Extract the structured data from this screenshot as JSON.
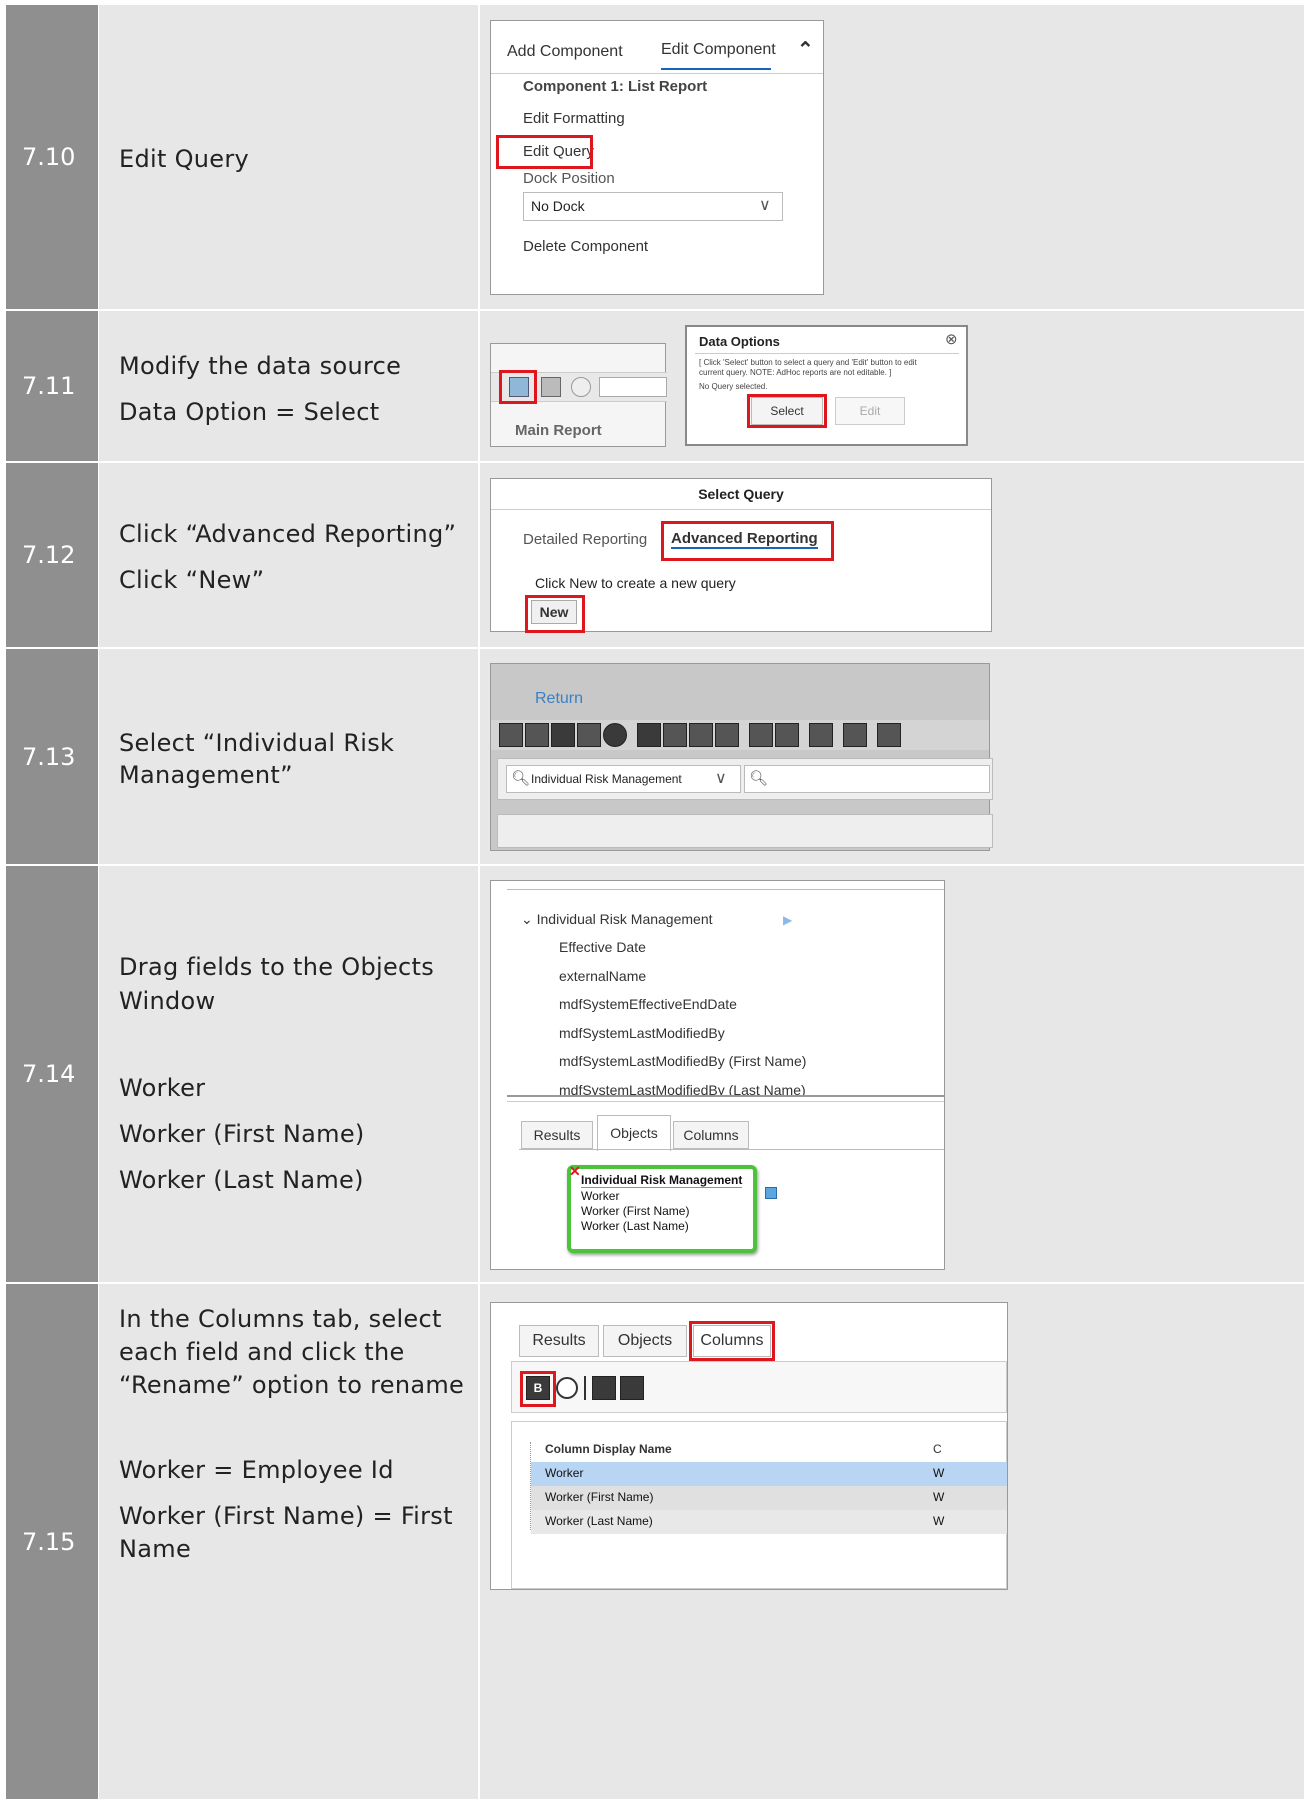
{
  "steps": [
    {
      "num": "7.10",
      "lines": [
        "Edit Query"
      ]
    },
    {
      "num": "7.11",
      "lines": [
        "Modify the data source",
        "Data Option = Select"
      ]
    },
    {
      "num": "7.12",
      "lines": [
        "Click “Advanced Reporting”",
        "Click “New”"
      ]
    },
    {
      "num": "7.13",
      "lines": [
        "Select “Individual Risk",
        "Management”"
      ]
    },
    {
      "num": "7.14",
      "lines": [
        "Drag fields to the Objects",
        "Window",
        "",
        "Worker",
        "Worker (First Name)",
        "Worker (Last Name)"
      ]
    },
    {
      "num": "7.15",
      "lines": [
        "In the Columns tab, select",
        "each field and click the",
        "“Rename” option to rename",
        "",
        "Worker = Employee Id",
        "Worker (First Name) = First",
        "Name"
      ]
    }
  ],
  "s710": {
    "tab_add": "Add Component",
    "tab_edit": "Edit Component",
    "heading": "Component 1: List Report",
    "edit_formatting": "Edit Formatting",
    "edit_query": "Edit Query",
    "dock_label": "Dock Position",
    "dock_value": "No Dock",
    "delete": "Delete Component"
  },
  "s711": {
    "main_report": "Main Report",
    "dialog_title": "Data Options",
    "dialog_note": "[ Click 'Select' button to select a query and 'Edit' button to edit current query. NOTE: AdHoc reports are not editable. ]",
    "no_query": "No Query selected.",
    "select": "Select",
    "edit": "Edit"
  },
  "s712": {
    "title": "Select Query",
    "tab_detailed": "Detailed Reporting",
    "tab_advanced": "Advanced Reporting",
    "hint": "Click New to create a new query",
    "new": "New"
  },
  "s713": {
    "return": "Return",
    "domain": "Individual Risk Management"
  },
  "s714": {
    "tree_root": "Individual Risk Management",
    "fields": [
      "Effective Date",
      "externalName",
      "mdfSystemEffectiveEndDate",
      "mdfSystemLastModifiedBy",
      "mdfSystemLastModifiedBy (First Name)",
      "mdfSystemLastModifiedBy (Last Name)"
    ],
    "tabs": [
      "Results",
      "Objects",
      "Columns"
    ],
    "obj_title": "Individual Risk Management",
    "obj_fields": [
      "Worker",
      "Worker (First Name)",
      "Worker (Last Name)"
    ]
  },
  "s715": {
    "tabs": [
      "Results",
      "Objects",
      "Columns"
    ],
    "col_header": "Column Display Name",
    "col_header2": "C",
    "rows": [
      "Worker",
      "Worker (First Name)",
      "Worker (Last Name)"
    ],
    "row_suffix": "W"
  }
}
